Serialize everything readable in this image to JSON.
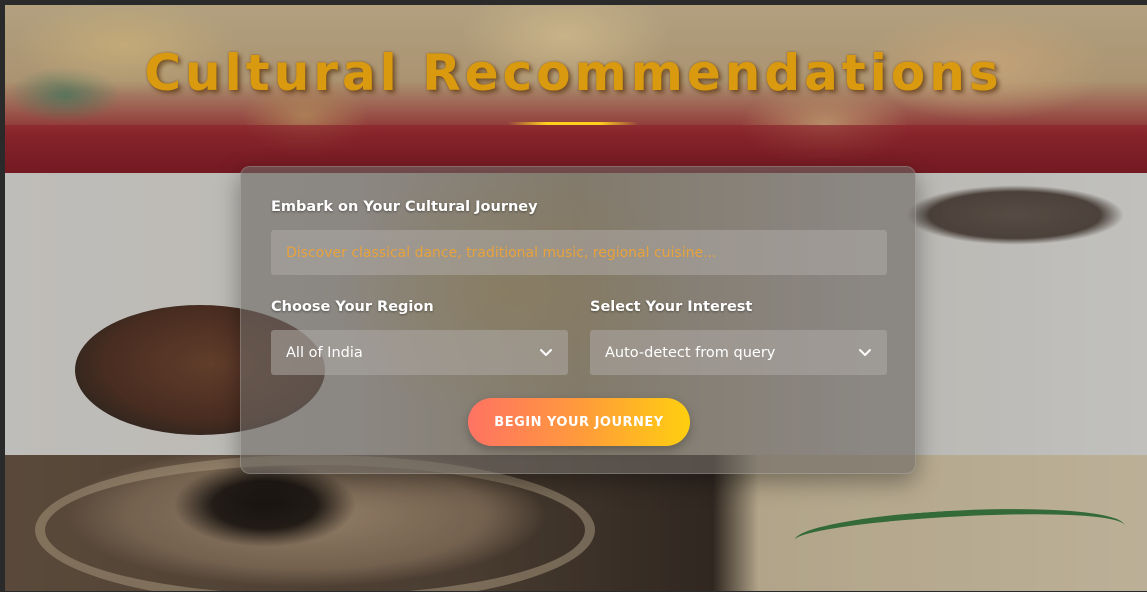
{
  "header": {
    "title": "Cultural Recommendations"
  },
  "form": {
    "journey_label": "Embark on Your Cultural Journey",
    "search_placeholder": "Discover classical dance, traditional music, regional cuisine...",
    "search_value": "",
    "region_label": "Choose Your Region",
    "region_selected": "All of India",
    "interest_label": "Select Your Interest",
    "interest_selected": "Auto-detect from query",
    "submit_label": "BEGIN YOUR JOURNEY"
  },
  "icons": {
    "region_chevron": "chevron-down-icon",
    "interest_chevron": "chevron-down-icon"
  },
  "colors": {
    "title": "#d99a10",
    "placeholder": "#e9a23a",
    "button_gradient_start": "#ff7363",
    "button_gradient_end": "#ffcf0f",
    "underline_accent": "#ffd21e"
  }
}
